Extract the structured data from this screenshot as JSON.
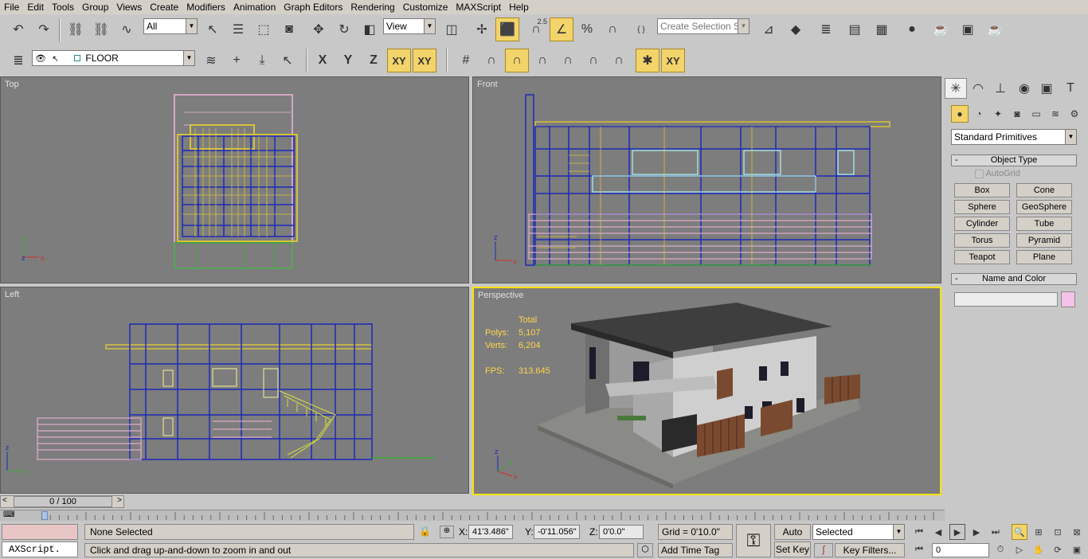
{
  "menu": [
    "File",
    "Edit",
    "Tools",
    "Group",
    "Views",
    "Create",
    "Modifiers",
    "Animation",
    "Graph Editors",
    "Rendering",
    "Customize",
    "MAXScript",
    "Help"
  ],
  "toolbar1": {
    "selection_filter": "All",
    "ref_coord": "View",
    "selection_set_placeholder": "Create Selection Set",
    "snap_angle_label": "2.5",
    "percent_label": "%"
  },
  "toolbar2": {
    "layer_name": "FLOOR",
    "axis_labels": [
      "X",
      "Y",
      "Z",
      "XY",
      "XY"
    ]
  },
  "viewports": {
    "top": {
      "label": "Top"
    },
    "front": {
      "label": "Front"
    },
    "left": {
      "label": "Left"
    },
    "perspective": {
      "label": "Perspective"
    }
  },
  "stats": {
    "total_label": "Total",
    "polys_label": "Polys:",
    "polys_value": "5,107",
    "verts_label": "Verts:",
    "verts_value": "6,204",
    "fps_label": "FPS:",
    "fps_value": "313.645"
  },
  "command_panel": {
    "category": "Standard Primitives",
    "object_type_title": "Object Type",
    "autogrid_label": "AutoGrid",
    "primitives": [
      "Box",
      "Cone",
      "Sphere",
      "GeoSphere",
      "Cylinder",
      "Tube",
      "Torus",
      "Pyramid",
      "Teapot",
      "Plane"
    ],
    "name_color_title": "Name and Color",
    "object_name": "",
    "object_color": "#f4c2e8"
  },
  "timeline": {
    "frame_label": "0 / 100",
    "frame_current": 0,
    "frame_total": 100
  },
  "status": {
    "maxscript_label": "AXScript.",
    "selection_status": "None Selected",
    "prompt": "Click and drag up-and-down to zoom in and out",
    "x_label": "X:",
    "x_value": "41'3.486\"",
    "y_label": "Y:",
    "y_value": "-0'11.056\"",
    "z_label": "Z:",
    "z_value": "0'0.0\"",
    "grid": "Grid = 0'10.0\"",
    "add_time_tag": "Add Time Tag",
    "auto_key": "Auto Key",
    "set_key": "Set Key",
    "key_mode": "Selected",
    "key_filters": "Key Filters...",
    "frame_field": "0"
  },
  "colors": {
    "viewport_bg": "#7d7d7d",
    "active_border": "#ffe200",
    "wire_blue": "#1c2ab8",
    "wire_yellow": "#d7c23a",
    "wire_pink": "#f2b6dc",
    "wire_green": "#3aa83a"
  }
}
